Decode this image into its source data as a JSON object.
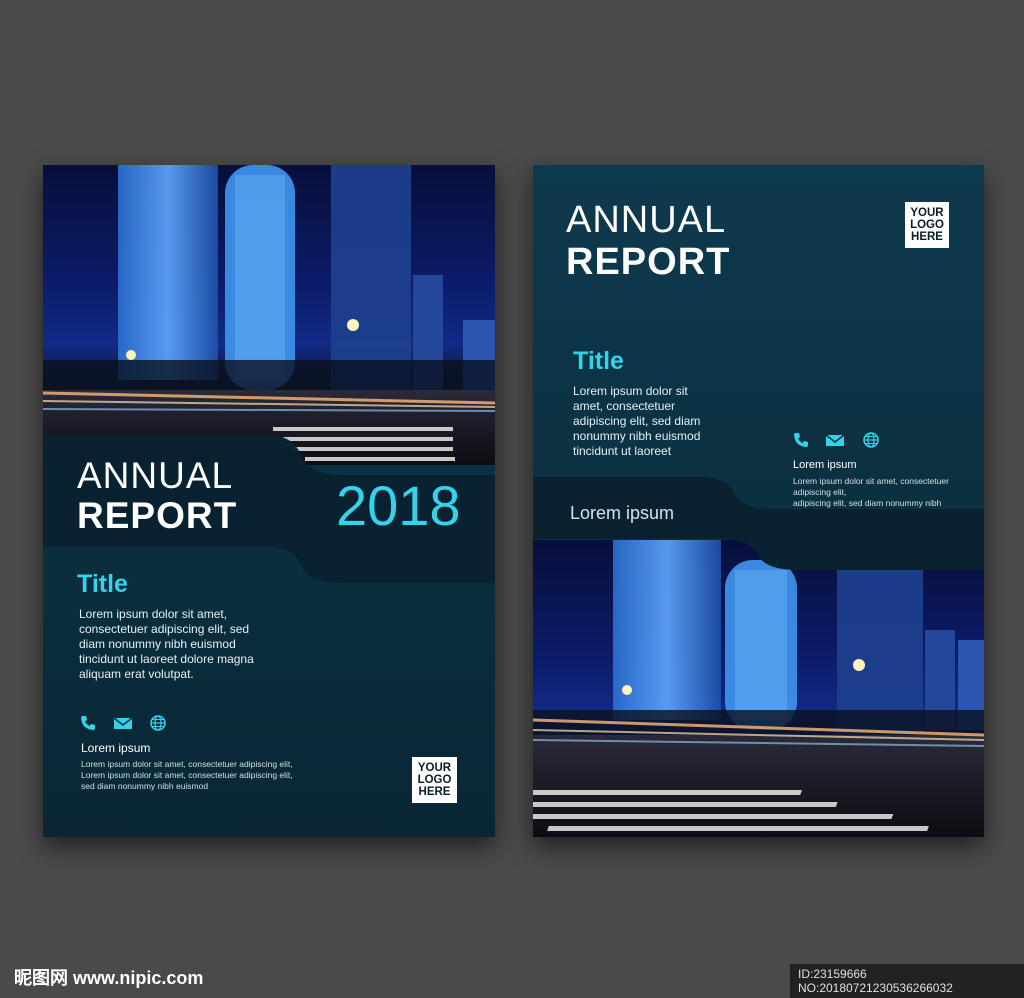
{
  "left_page": {
    "annual": "ANNUAL",
    "report": "REPORT",
    "year": "2018",
    "title": "Title",
    "body_lines": [
      "Lorem ipsum dolor sit amet,",
      "consectetuer adipiscing elit, sed",
      "diam nonummy nibh euismod",
      "tincidunt ut laoreet dolore magna",
      "aliquam erat volutpat."
    ],
    "icons": [
      "phone-icon",
      "mail-icon",
      "globe-icon"
    ],
    "lorem_label": "Lorem ipsum",
    "small_lines": [
      "Lorem ipsum dolor sit amet, consectetuer adipiscing elit,",
      "Lorem ipsum dolor sit amet, consectetuer adipiscing elit,",
      "sed diam nonummy nibh euismod"
    ],
    "logo": [
      "YOUR",
      "LOGO",
      "HERE"
    ]
  },
  "right_page": {
    "annual": "ANNUAL",
    "report": "REPORT",
    "logo": [
      "YOUR",
      "LOGO",
      "HERE"
    ],
    "title": "Title",
    "body_lines": [
      "Lorem ipsum dolor sit",
      "amet, consectetuer",
      "adipiscing elit, sed diam",
      "nonummy nibh euismod",
      "tincidunt ut laoreet"
    ],
    "icons": [
      "phone-icon",
      "mail-icon",
      "globe-icon"
    ],
    "lorem_label": "Lorem ipsum",
    "small_lines": [
      "Lorem ipsum dolor sit amet, consectetuer adipiscing elit,",
      "adipiscing elit, sed diam nonummy nibh"
    ],
    "band_label": "Lorem ipsum"
  },
  "watermark": {
    "site": "昵图网 www.nipic.com",
    "id_text": "ID:23159666 NO:20180721230536266032"
  },
  "colors": {
    "accent": "#33d3ea",
    "page_bg": "#0e3a4e",
    "band_dark": "#0a2230",
    "background": "#4a4a4a"
  }
}
